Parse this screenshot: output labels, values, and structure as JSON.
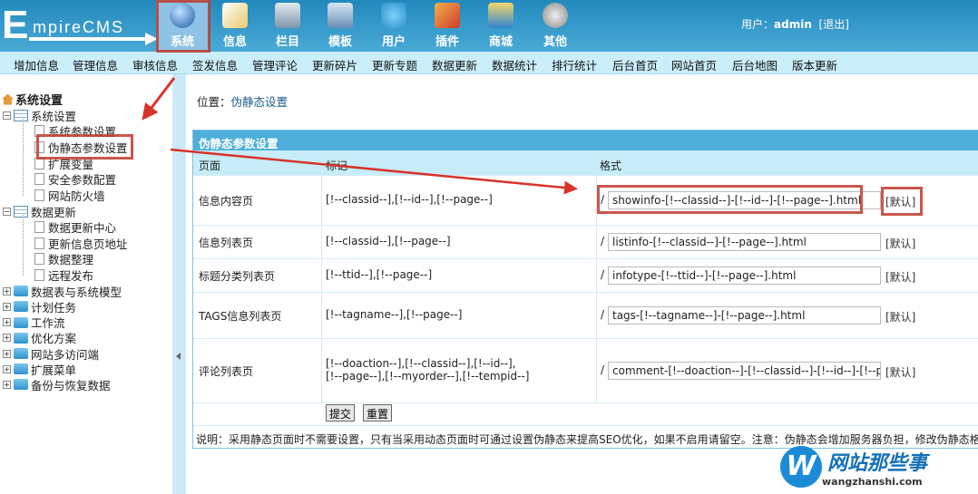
{
  "header": {
    "logo": "EmpireCMS",
    "tabs": [
      {
        "label": "系统",
        "active": true
      },
      {
        "label": "信息"
      },
      {
        "label": "栏目"
      },
      {
        "label": "模板"
      },
      {
        "label": "用户"
      },
      {
        "label": "插件"
      },
      {
        "label": "商城"
      },
      {
        "label": "其他"
      }
    ],
    "user_label": "用户：",
    "user_name": "admin",
    "logout": "[退出]"
  },
  "nav": [
    "增加信息",
    "管理信息",
    "审核信息",
    "签发信息",
    "管理评论",
    "更新碎片",
    "更新专题",
    "数据更新",
    "数据统计",
    "排行统计",
    "后台首页",
    "网站首页",
    "后台地图",
    "版本更新"
  ],
  "sidebar": {
    "title": "系统设置",
    "groups": [
      {
        "label": "系统设置",
        "open": true,
        "items": [
          "系统参数设置",
          "伪静态参数设置",
          "扩展变量",
          "安全参数配置",
          "网站防火墙"
        ]
      },
      {
        "label": "数据更新",
        "open": true,
        "items": [
          "数据更新中心",
          "更新信息页地址",
          "数据整理",
          "远程发布"
        ]
      },
      {
        "label": "数据表与系统模型"
      },
      {
        "label": "计划任务"
      },
      {
        "label": "工作流"
      },
      {
        "label": "优化方案"
      },
      {
        "label": "网站多访问端"
      },
      {
        "label": "扩展菜单"
      },
      {
        "label": "备份与恢复数据"
      }
    ]
  },
  "location": {
    "label": "位置：",
    "page": "伪静态设置"
  },
  "form": {
    "title": "伪静态参数设置",
    "columns": [
      "页面",
      "标记",
      "格式"
    ],
    "rows": [
      {
        "page": "信息内容页",
        "tags": "[!--classid--],[!--id--],[!--page--]",
        "format": "showinfo-[!--classid--]-[!--id--]-[!--page--].html"
      },
      {
        "page": "信息列表页",
        "tags": "[!--classid--],[!--page--]",
        "format": "listinfo-[!--classid--]-[!--page--].html"
      },
      {
        "page": "标题分类列表页",
        "tags": "[!--ttid--],[!--page--]",
        "format": "infotype-[!--ttid--]-[!--page--].html"
      },
      {
        "page": "TAGS信息列表页",
        "tags": "[!--tagname--],[!--page--]",
        "format": "tags-[!--tagname--]-[!--page--].html"
      },
      {
        "page": "评论列表页",
        "tags": "[!--doaction--],[!--classid--],[!--id--],",
        "tags2": "[!--page--],[!--myorder--],[!--tempid--]",
        "format": "comment-[!--doaction--]-[!--classid--]-[!--id--]-[!--page--].html"
      }
    ],
    "slash": "/",
    "default_label": "[默认]",
    "submit": "提交",
    "reset": "重置",
    "note": "说明：采用静态页面时不需要设置，只有当采用动态页面时可通过设置伪静态来提高SEO优化，如果不启用请留空。注意：伪静态会增加服务器负担，修改伪静态格式"
  },
  "watermark": {
    "logo": "W",
    "name": "网站那些事",
    "url": "wangzhanshi.com"
  },
  "colors": {
    "header": "#2a8fc0",
    "nav": "#cbeefb",
    "table_caption": "#4eb0da",
    "annotation": "#c0392b"
  }
}
